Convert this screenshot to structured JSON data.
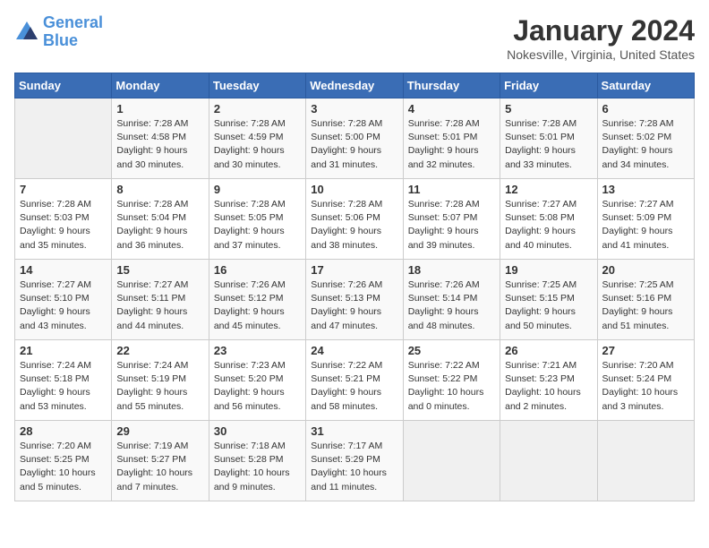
{
  "logo": {
    "text_general": "General",
    "text_blue": "Blue"
  },
  "header": {
    "title": "January 2024",
    "subtitle": "Nokesville, Virginia, United States"
  },
  "weekdays": [
    "Sunday",
    "Monday",
    "Tuesday",
    "Wednesday",
    "Thursday",
    "Friday",
    "Saturday"
  ],
  "weeks": [
    [
      {
        "day": "",
        "info": ""
      },
      {
        "day": "1",
        "info": "Sunrise: 7:28 AM\nSunset: 4:58 PM\nDaylight: 9 hours\nand 30 minutes."
      },
      {
        "day": "2",
        "info": "Sunrise: 7:28 AM\nSunset: 4:59 PM\nDaylight: 9 hours\nand 30 minutes."
      },
      {
        "day": "3",
        "info": "Sunrise: 7:28 AM\nSunset: 5:00 PM\nDaylight: 9 hours\nand 31 minutes."
      },
      {
        "day": "4",
        "info": "Sunrise: 7:28 AM\nSunset: 5:01 PM\nDaylight: 9 hours\nand 32 minutes."
      },
      {
        "day": "5",
        "info": "Sunrise: 7:28 AM\nSunset: 5:01 PM\nDaylight: 9 hours\nand 33 minutes."
      },
      {
        "day": "6",
        "info": "Sunrise: 7:28 AM\nSunset: 5:02 PM\nDaylight: 9 hours\nand 34 minutes."
      }
    ],
    [
      {
        "day": "7",
        "info": "Sunrise: 7:28 AM\nSunset: 5:03 PM\nDaylight: 9 hours\nand 35 minutes."
      },
      {
        "day": "8",
        "info": "Sunrise: 7:28 AM\nSunset: 5:04 PM\nDaylight: 9 hours\nand 36 minutes."
      },
      {
        "day": "9",
        "info": "Sunrise: 7:28 AM\nSunset: 5:05 PM\nDaylight: 9 hours\nand 37 minutes."
      },
      {
        "day": "10",
        "info": "Sunrise: 7:28 AM\nSunset: 5:06 PM\nDaylight: 9 hours\nand 38 minutes."
      },
      {
        "day": "11",
        "info": "Sunrise: 7:28 AM\nSunset: 5:07 PM\nDaylight: 9 hours\nand 39 minutes."
      },
      {
        "day": "12",
        "info": "Sunrise: 7:27 AM\nSunset: 5:08 PM\nDaylight: 9 hours\nand 40 minutes."
      },
      {
        "day": "13",
        "info": "Sunrise: 7:27 AM\nSunset: 5:09 PM\nDaylight: 9 hours\nand 41 minutes."
      }
    ],
    [
      {
        "day": "14",
        "info": "Sunrise: 7:27 AM\nSunset: 5:10 PM\nDaylight: 9 hours\nand 43 minutes."
      },
      {
        "day": "15",
        "info": "Sunrise: 7:27 AM\nSunset: 5:11 PM\nDaylight: 9 hours\nand 44 minutes."
      },
      {
        "day": "16",
        "info": "Sunrise: 7:26 AM\nSunset: 5:12 PM\nDaylight: 9 hours\nand 45 minutes."
      },
      {
        "day": "17",
        "info": "Sunrise: 7:26 AM\nSunset: 5:13 PM\nDaylight: 9 hours\nand 47 minutes."
      },
      {
        "day": "18",
        "info": "Sunrise: 7:26 AM\nSunset: 5:14 PM\nDaylight: 9 hours\nand 48 minutes."
      },
      {
        "day": "19",
        "info": "Sunrise: 7:25 AM\nSunset: 5:15 PM\nDaylight: 9 hours\nand 50 minutes."
      },
      {
        "day": "20",
        "info": "Sunrise: 7:25 AM\nSunset: 5:16 PM\nDaylight: 9 hours\nand 51 minutes."
      }
    ],
    [
      {
        "day": "21",
        "info": "Sunrise: 7:24 AM\nSunset: 5:18 PM\nDaylight: 9 hours\nand 53 minutes."
      },
      {
        "day": "22",
        "info": "Sunrise: 7:24 AM\nSunset: 5:19 PM\nDaylight: 9 hours\nand 55 minutes."
      },
      {
        "day": "23",
        "info": "Sunrise: 7:23 AM\nSunset: 5:20 PM\nDaylight: 9 hours\nand 56 minutes."
      },
      {
        "day": "24",
        "info": "Sunrise: 7:22 AM\nSunset: 5:21 PM\nDaylight: 9 hours\nand 58 minutes."
      },
      {
        "day": "25",
        "info": "Sunrise: 7:22 AM\nSunset: 5:22 PM\nDaylight: 10 hours\nand 0 minutes."
      },
      {
        "day": "26",
        "info": "Sunrise: 7:21 AM\nSunset: 5:23 PM\nDaylight: 10 hours\nand 2 minutes."
      },
      {
        "day": "27",
        "info": "Sunrise: 7:20 AM\nSunset: 5:24 PM\nDaylight: 10 hours\nand 3 minutes."
      }
    ],
    [
      {
        "day": "28",
        "info": "Sunrise: 7:20 AM\nSunset: 5:25 PM\nDaylight: 10 hours\nand 5 minutes."
      },
      {
        "day": "29",
        "info": "Sunrise: 7:19 AM\nSunset: 5:27 PM\nDaylight: 10 hours\nand 7 minutes."
      },
      {
        "day": "30",
        "info": "Sunrise: 7:18 AM\nSunset: 5:28 PM\nDaylight: 10 hours\nand 9 minutes."
      },
      {
        "day": "31",
        "info": "Sunrise: 7:17 AM\nSunset: 5:29 PM\nDaylight: 10 hours\nand 11 minutes."
      },
      {
        "day": "",
        "info": ""
      },
      {
        "day": "",
        "info": ""
      },
      {
        "day": "",
        "info": ""
      }
    ]
  ]
}
